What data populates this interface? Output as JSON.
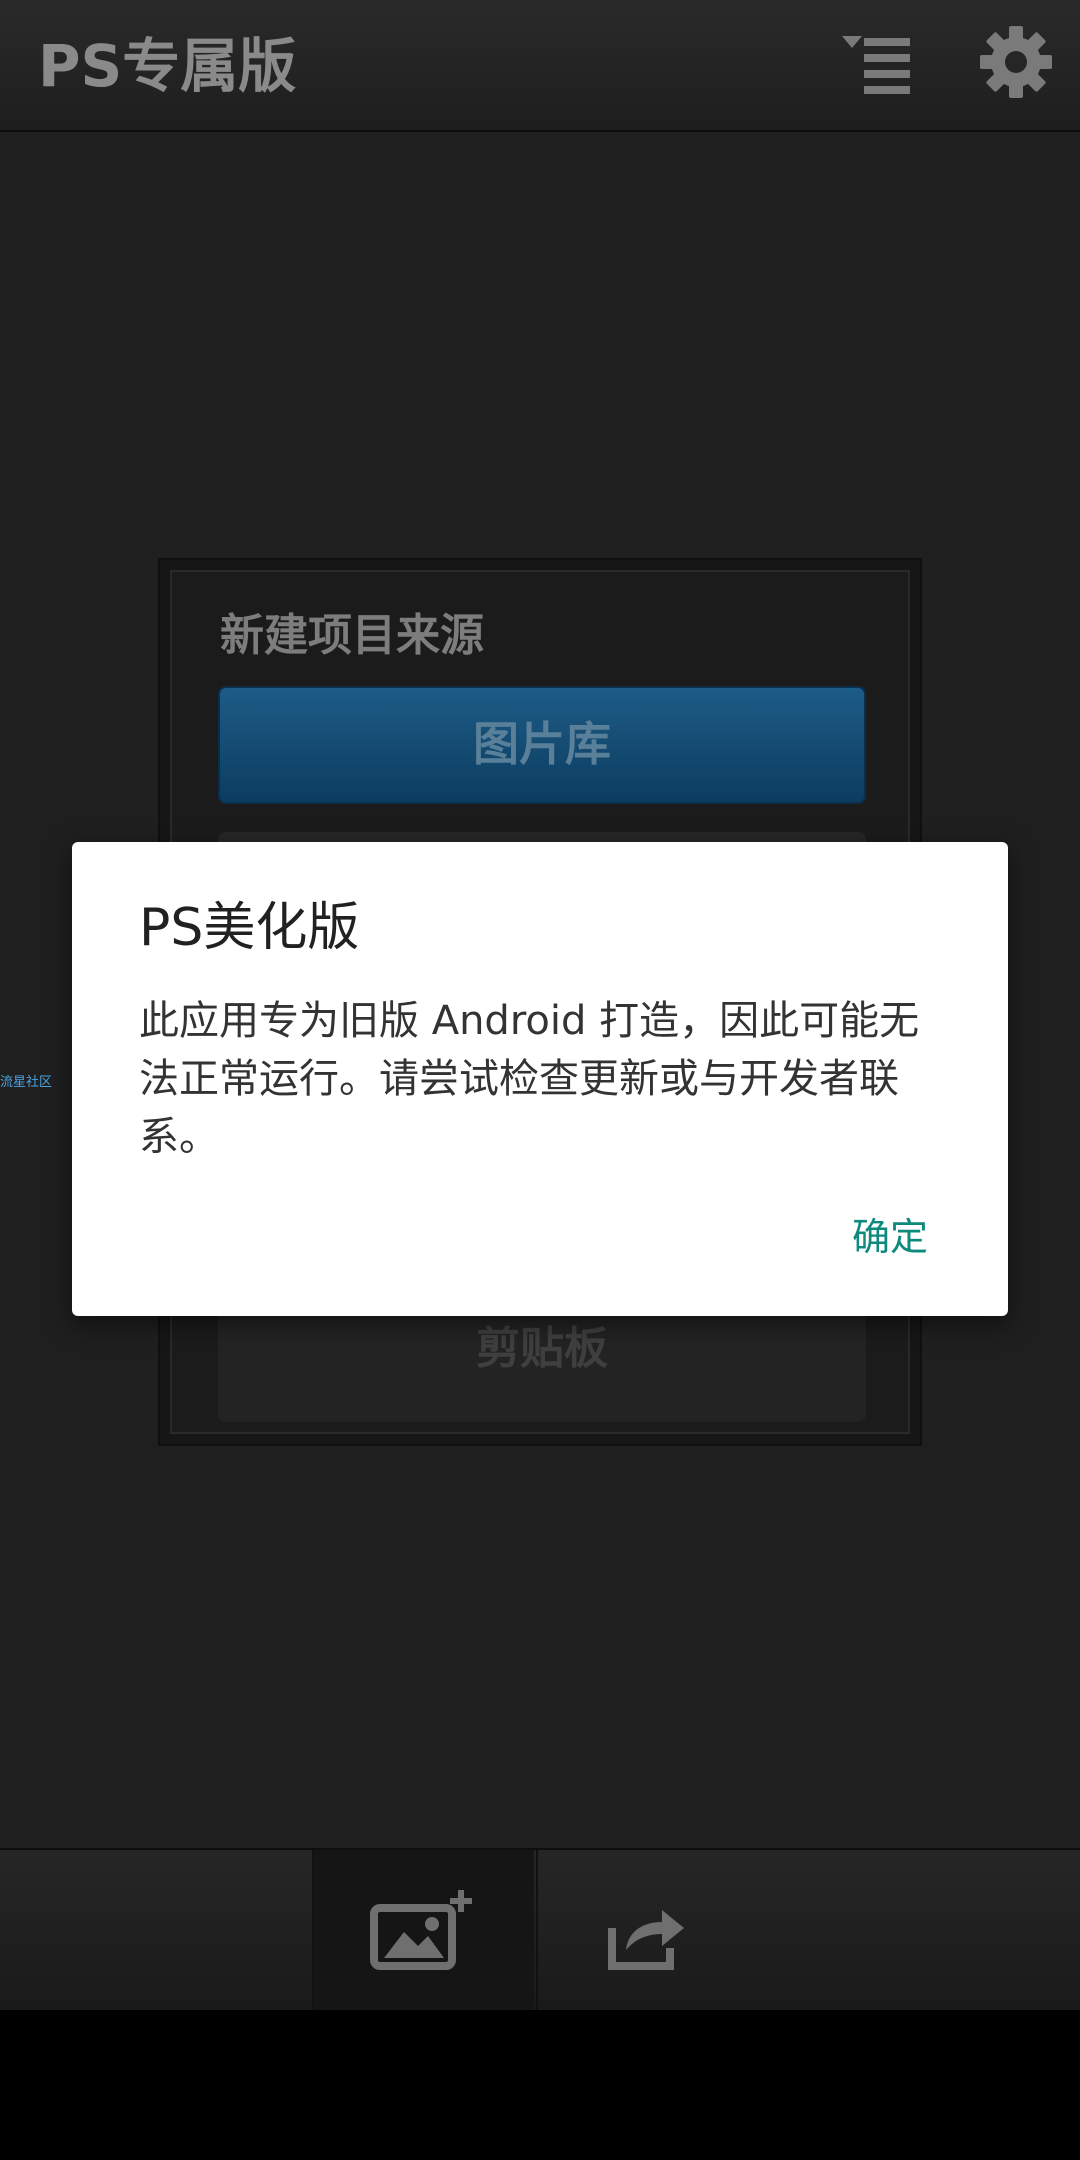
{
  "app": {
    "title": "PS专属版",
    "side_label": "流星社区"
  },
  "source_panel": {
    "title": "新建项目来源",
    "gallery_label": "图片库",
    "clipboard_label": "剪贴板"
  },
  "dialog": {
    "title": "PS美化版",
    "message": "此应用专为旧版 Android 打造，因此可能无法正常运行。请尝试检查更新或与开发者联系。",
    "ok_label": "确定"
  },
  "icons": {
    "menu": "menu-list-icon",
    "settings": "gear-icon",
    "add_image": "add-image-icon",
    "share": "share-icon"
  },
  "colors": {
    "accent_teal": "#0e8a7d",
    "gallery_blue": "#1d5c86",
    "topbar_text": "#8a8a8a"
  }
}
